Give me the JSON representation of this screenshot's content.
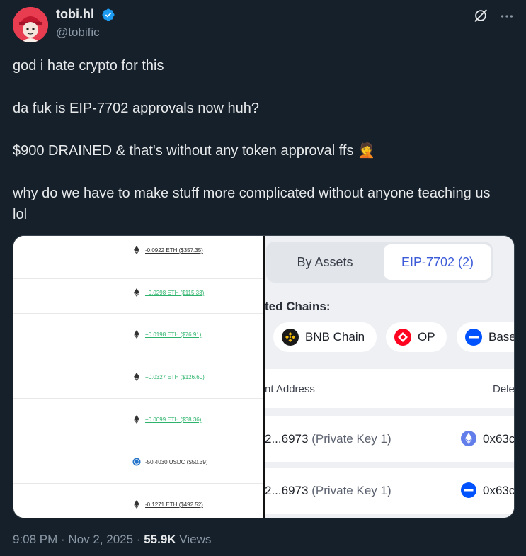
{
  "author": {
    "name": "tobi.hl",
    "handle": "@tobific"
  },
  "tweet": {
    "lines": [
      "god i hate crypto for this",
      "da fuk is EIP-7702 approvals now huh?",
      "$900 DRAINED & that's without any token approval ffs 🤦",
      "why do we have to make stuff more complicated without anyone teaching us lol"
    ]
  },
  "media": {
    "transactions": [
      {
        "text": "-0.0922 ETH ($357.35)",
        "kind": "neg",
        "asset": "eth-icon"
      },
      {
        "text": "+0.0298 ETH ($115.33)",
        "kind": "pos",
        "asset": "eth-icon"
      },
      {
        "text": "+0.0198 ETH ($76.91)",
        "kind": "pos",
        "asset": "eth-icon"
      },
      {
        "text": "+0.0327 ETH ($126.60)",
        "kind": "pos",
        "asset": "eth-icon"
      },
      {
        "text": "+0.0099 ETH ($38.36)",
        "kind": "pos",
        "asset": "eth-icon"
      },
      {
        "text": "-50.4030 USDC ($50.39)",
        "kind": "neg",
        "asset": "usdc-icon"
      },
      {
        "text": "-0.1271 ETH ($492.52)",
        "kind": "neg",
        "asset": "eth-icon"
      }
    ],
    "tabs": [
      "By Assets",
      "EIP-7702 (2)"
    ],
    "chains_label": "ted Chains:",
    "chains": [
      "BNB Chain",
      "OP",
      "Base"
    ],
    "table_headers": [
      "nt Address",
      "Dele"
    ],
    "rows": [
      {
        "address": "2...6973",
        "key": "(Private Key 1)",
        "delegate": "0x63c",
        "icon": "eth-icon"
      },
      {
        "address": "2...6973",
        "key": "(Private Key 1)",
        "delegate": "0x63c",
        "icon": "base-icon"
      }
    ]
  },
  "meta": {
    "time": "9:08 PM · Nov 2, 2025 · ",
    "views_count": "55.9K",
    "views_label": " Views"
  },
  "colors": {
    "background": "#15202b",
    "verified": "#1d9bf0",
    "positive": "#2db36b",
    "tab_active": "#3b5bd9"
  }
}
